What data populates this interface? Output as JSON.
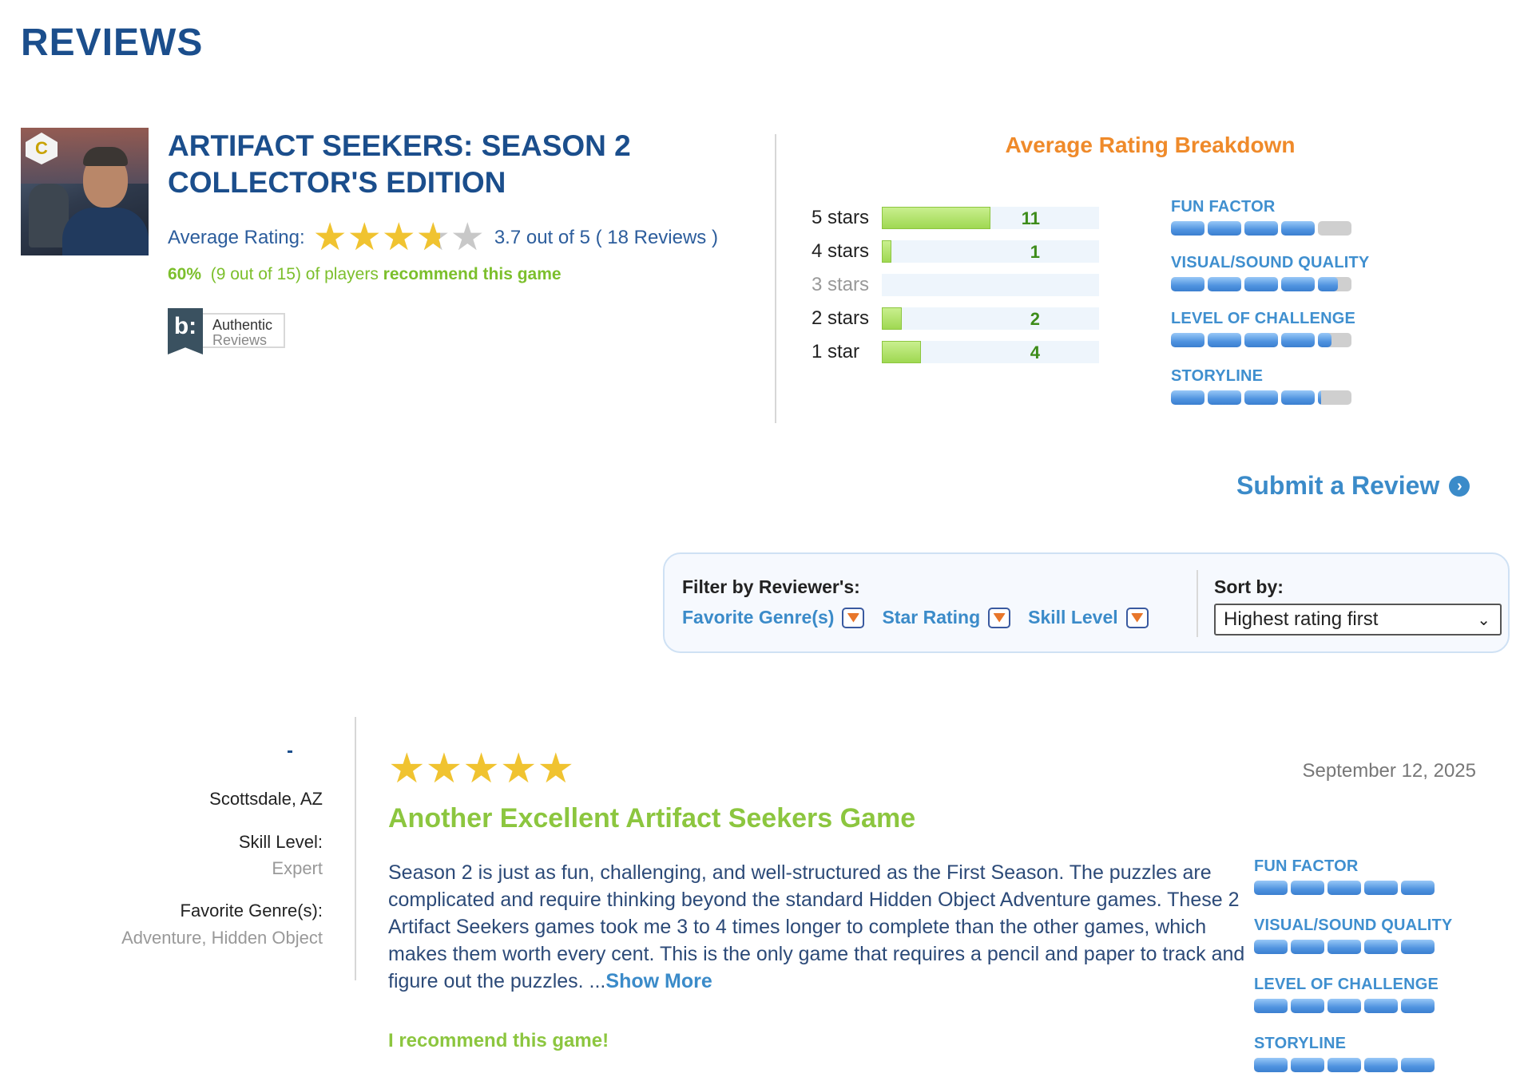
{
  "page": {
    "title": "REVIEWS"
  },
  "product": {
    "title": "ARTIFACT SEEKERS: SEASON 2 COLLECTOR'S EDITION",
    "average_label": "Average Rating:",
    "average_value": 3.7,
    "average_text": "3.7 out of 5 ( 18 Reviews )",
    "recommend_pct": "60%",
    "recommend_detail": "(9 out of 15) of players",
    "recommend_tail": "recommend this game",
    "authentic_l1": "Authentic",
    "authentic_l2": "Reviews",
    "authentic_logo": "b:"
  },
  "breakdown": {
    "title": "Average Rating Breakdown",
    "rows": [
      {
        "label": "5 stars",
        "count": "11",
        "value": 11
      },
      {
        "label": "4 stars",
        "count": "1",
        "value": 1
      },
      {
        "label": "3 stars",
        "count": "",
        "value": 0
      },
      {
        "label": "2 stars",
        "count": "2",
        "value": 2
      },
      {
        "label": "1 star",
        "count": "4",
        "value": 4
      }
    ],
    "max": 11,
    "categories": [
      {
        "label": "FUN FACTOR",
        "rating": 4.0
      },
      {
        "label": "VISUAL/SOUND QUALITY",
        "rating": 4.6
      },
      {
        "label": "LEVEL OF CHALLENGE",
        "rating": 4.4
      },
      {
        "label": "STORYLINE",
        "rating": 4.1
      }
    ]
  },
  "submit": {
    "label": "Submit a Review",
    "icon": "arrow-right-circle-icon"
  },
  "filter": {
    "heading": "Filter by Reviewer's:",
    "options": [
      "Favorite Genre(s)",
      "Star Rating",
      "Skill Level"
    ],
    "sort_heading": "Sort by:",
    "sort_value": "Highest rating first"
  },
  "review": {
    "location": "Scottsdale, AZ",
    "skill_label": "Skill Level:",
    "skill_value": "Expert",
    "genre_label": "Favorite Genre(s):",
    "genre_value": "Adventure, Hidden Object",
    "stars": 5,
    "date": "September 12, 2025",
    "title": "Another Excellent Artifact Seekers Game",
    "body": "Season 2 is just as fun, challenging, and well-structured as the First Season. The puzzles are complicated and require thinking beyond the standard Hidden Object Adventure games. These 2 Artifact Seekers games took me 3 to 4 times longer to complete than the other games, which makes them worth every cent. This is the only game that requires a pencil and paper to track and figure out the puzzles. ...",
    "show_more": "Show More",
    "recommend": "I recommend this game!",
    "categories": [
      {
        "label": "FUN FACTOR",
        "rating": 5
      },
      {
        "label": "VISUAL/SOUND QUALITY",
        "rating": 5
      },
      {
        "label": "LEVEL OF CHALLENGE",
        "rating": 5
      },
      {
        "label": "STORYLINE",
        "rating": 5
      }
    ]
  },
  "colors": {
    "brand_blue": "#1b4e8c",
    "link_blue": "#3b8bc9",
    "accent_orange": "#ef8a2a",
    "green": "#8cc63f",
    "star_gold": "#f0c330"
  }
}
